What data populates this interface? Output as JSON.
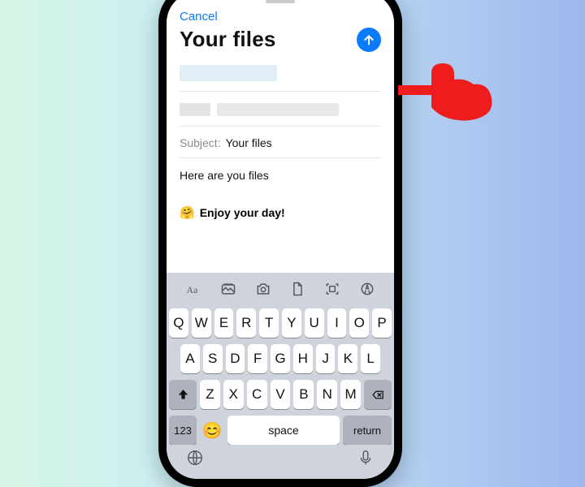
{
  "header": {
    "cancel": "Cancel",
    "title": "Your files"
  },
  "compose": {
    "subject_label": "Subject:",
    "subject_value": "Your files",
    "body": "Here are you files",
    "signature_emoji": "🤗",
    "signature_text": "Enjoy your day!"
  },
  "keyboard": {
    "row1": [
      "Q",
      "W",
      "E",
      "R",
      "T",
      "Y",
      "U",
      "I",
      "O",
      "P"
    ],
    "row2": [
      "A",
      "S",
      "D",
      "F",
      "G",
      "H",
      "J",
      "K",
      "L"
    ],
    "row3": [
      "Z",
      "X",
      "C",
      "V",
      "B",
      "N",
      "M"
    ],
    "num_key": "123",
    "space": "space",
    "return": "return"
  }
}
